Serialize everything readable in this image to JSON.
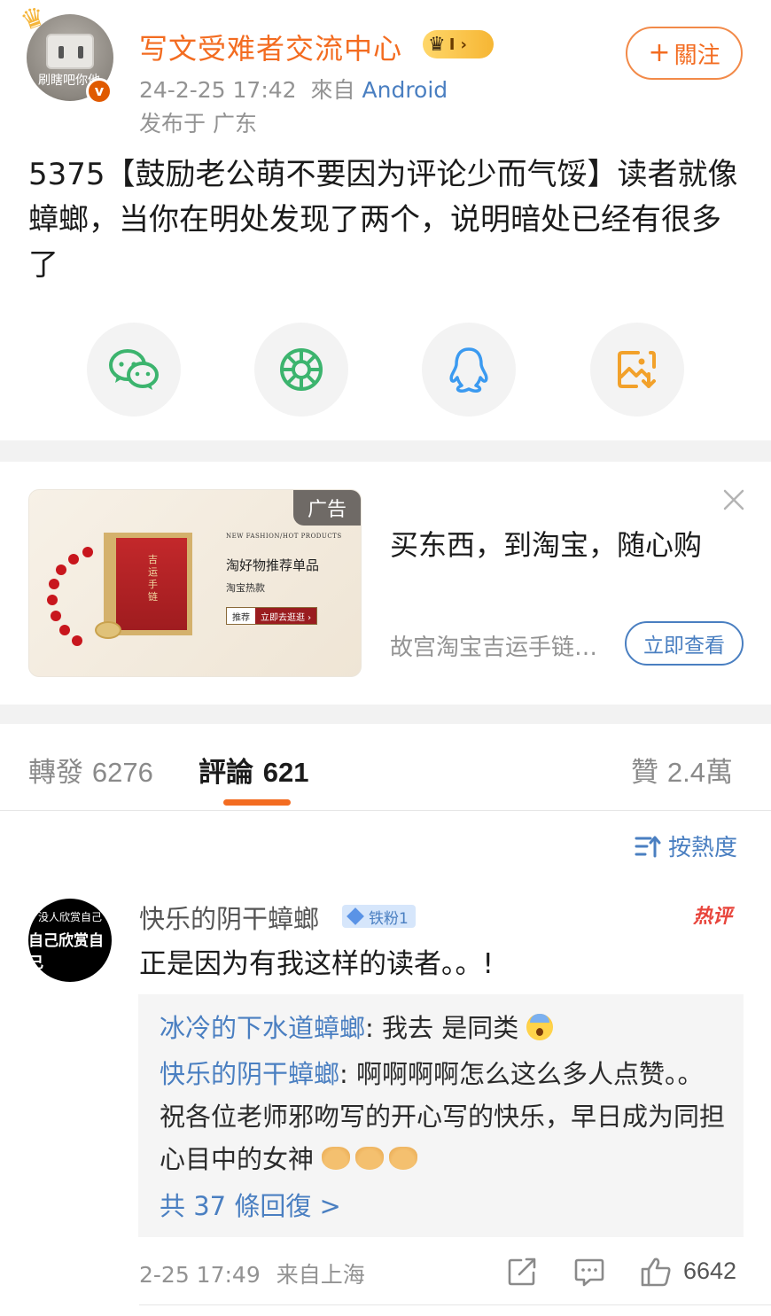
{
  "post": {
    "avatar_text": "刷瞎吧你他",
    "username": "写文受难者交流中心",
    "vip_level": "I",
    "time": "24-2-25 17:42",
    "from_label": "來自",
    "source": "Android",
    "location": "发布于 广东",
    "follow_label": "關注",
    "text": "5375【鼓励老公萌不要因为评论少而气馁】读者就像蟑螂，当你在明处发现了两个，说明暗处已经有很多了"
  },
  "share": {
    "icons": [
      "wechat-icon",
      "moments-icon",
      "qq-icon",
      "save-image-icon"
    ]
  },
  "ad": {
    "tag": "广告",
    "image_en": "NEW FASHION/HOT PRODUCTS",
    "image_title": "淘好物推荐单品",
    "image_sub": "淘宝热款",
    "image_pill_a": "推荐",
    "image_pill_b": "立即去逛逛 ›",
    "box_text": "吉运手链",
    "title": "买东西，到淘宝，随心购",
    "description": "故宫淘宝吉运手链…",
    "button": "立即查看"
  },
  "tabs": {
    "repost_label": "轉發",
    "repost_count": "6276",
    "comment_label": "評論",
    "comment_count": "621",
    "like_label": "贊",
    "like_count": "2.4萬"
  },
  "sort": {
    "label": "按熱度"
  },
  "comment": {
    "avatar_line1": "没人欣赏自己",
    "avatar_line2": "自己欣赏自己",
    "name": "快乐的阴干蟑螂",
    "fan_badge": "铁粉1",
    "hot_tag": "热评",
    "text": "正是因为有我这样的读者。。!",
    "replies": [
      {
        "name": "冰冷的下水道蟑螂",
        "text": ": 我去 是同类"
      },
      {
        "name": "快乐的阴干蟑螂",
        "text": ": 啊啊啊啊怎么这么多人点赞。。祝各位老师邪吻写的开心写的快乐，早日成为同担心目中的女神"
      }
    ],
    "more_replies": "共 37 條回復 >",
    "time": "2-25 17:49",
    "location": "来自上海",
    "like_count": "6642"
  },
  "colors": {
    "accent_orange": "#f36c21",
    "link_blue": "#4a7fc1",
    "meta_gray": "#939393"
  }
}
